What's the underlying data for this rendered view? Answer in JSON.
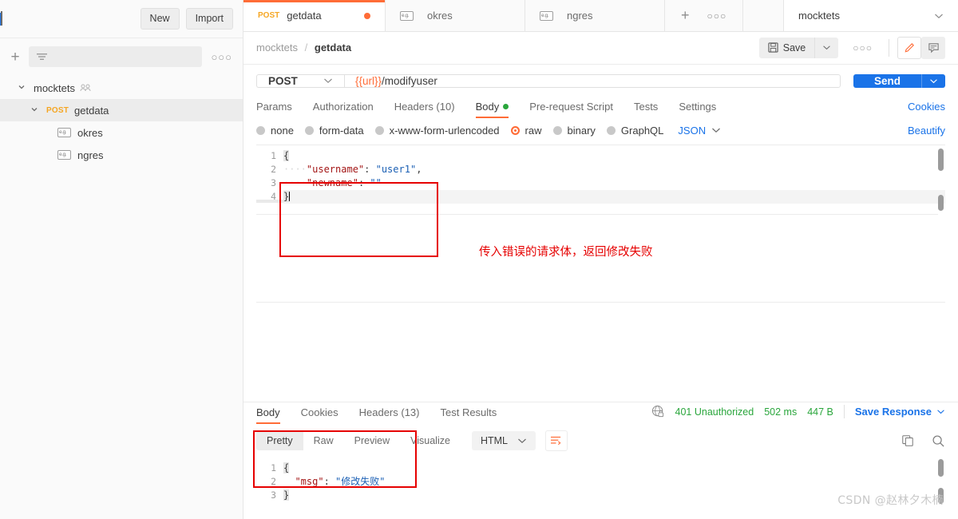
{
  "sidebar": {
    "new_label": "New",
    "import_label": "Import",
    "filter_placeholder": "",
    "more_label": "○○○",
    "tree": [
      {
        "label": "mocktets",
        "type": "collection",
        "icon": "team-icon",
        "expanded": true
      },
      {
        "label": "getdata",
        "type": "request",
        "method": "POST",
        "expanded": true,
        "selected": true
      },
      {
        "label": "okres",
        "type": "example",
        "icon": "example-icon"
      },
      {
        "label": "ngres",
        "type": "example",
        "icon": "example-icon"
      }
    ]
  },
  "tabs": [
    {
      "method": "POST",
      "label": "getdata",
      "active": true,
      "unsaved": true
    },
    {
      "method": "",
      "label": "okres",
      "active": false,
      "icon": "example-icon"
    },
    {
      "method": "",
      "label": "ngres",
      "active": false,
      "icon": "example-icon"
    }
  ],
  "tabbar": {
    "add_label": "+",
    "more_label": "○○○"
  },
  "environment": {
    "selected": "mocktets",
    "caret": "⌄"
  },
  "breadcrumb": {
    "collection": "mocktets",
    "separator": "/",
    "request": "getdata"
  },
  "toolbar": {
    "save_label": "Save",
    "save_caret": "⌄",
    "more_label": "○○○",
    "edit_icon": "pencil-icon",
    "comment_icon": "comment-icon"
  },
  "request": {
    "method": "POST",
    "method_caret": "⌄",
    "url_variable": "{{url}}",
    "url_path": "/modifyuser",
    "send_label": "Send",
    "send_caret": "⌄"
  },
  "request_tabs": [
    {
      "label": "Params",
      "active": false
    },
    {
      "label": "Authorization",
      "active": false
    },
    {
      "label": "Headers (10)",
      "active": false
    },
    {
      "label": "Body",
      "active": true,
      "dot": true
    },
    {
      "label": "Pre-request Script",
      "active": false
    },
    {
      "label": "Tests",
      "active": false
    },
    {
      "label": "Settings",
      "active": false
    }
  ],
  "cookies_link": "Cookies",
  "body_types": [
    {
      "label": "none",
      "selected": false
    },
    {
      "label": "form-data",
      "selected": false
    },
    {
      "label": "x-www-form-urlencoded",
      "selected": false
    },
    {
      "label": "raw",
      "selected": true
    },
    {
      "label": "binary",
      "selected": false
    },
    {
      "label": "GraphQL",
      "selected": false
    }
  ],
  "body_format": {
    "label": "JSON",
    "caret": "⌄"
  },
  "beautify_label": "Beautify",
  "request_body": {
    "line_numbers": [
      "1",
      "2",
      "3",
      "4"
    ],
    "lines": [
      {
        "n": "1",
        "text": "{"
      },
      {
        "n": "2",
        "indent": "····",
        "key": "\"username\"",
        "punc": ": ",
        "value": "\"user1\"",
        "tail": ","
      },
      {
        "n": "3",
        "indent": "····",
        "key": "\"newname\"",
        "punc": ": ",
        "value": "\"\"",
        "tail": ""
      },
      {
        "n": "4",
        "text": "}"
      }
    ]
  },
  "annotation": {
    "request_note": "传入错误的请求体，返回修改失败"
  },
  "response_tabs": [
    {
      "label": "Body",
      "active": true
    },
    {
      "label": "Cookies",
      "active": false
    },
    {
      "label": "Headers (13)",
      "active": false
    },
    {
      "label": "Test Results",
      "active": false
    }
  ],
  "response_meta": {
    "status_icon": "globe-lock-icon",
    "status": "401 Unauthorized",
    "time": "502 ms",
    "size": "447 B",
    "save_response": "Save Response",
    "save_response_caret": "⌄"
  },
  "response_tools": {
    "views": [
      {
        "label": "Pretty",
        "active": true
      },
      {
        "label": "Raw",
        "active": false
      },
      {
        "label": "Preview",
        "active": false
      },
      {
        "label": "Visualize",
        "active": false
      }
    ],
    "format": {
      "label": "HTML",
      "caret": "⌄"
    },
    "wrap_icon": "wrap-lines-icon",
    "copy_icon": "copy-icon",
    "search_icon": "search-icon"
  },
  "response_body": {
    "lines": [
      {
        "n": "1",
        "text": "{"
      },
      {
        "n": "2",
        "key": "\"msg\"",
        "punc": ": ",
        "value": "\"修改失败\""
      },
      {
        "n": "3",
        "text": "}"
      }
    ]
  },
  "watermark": "CSDN @赵林夕木楠",
  "colors": {
    "accent": "#ff6c37",
    "send": "#1a73e8",
    "annotation": "#e60000",
    "status_ok": "#2aa63c",
    "method_post": "#f5a623"
  }
}
